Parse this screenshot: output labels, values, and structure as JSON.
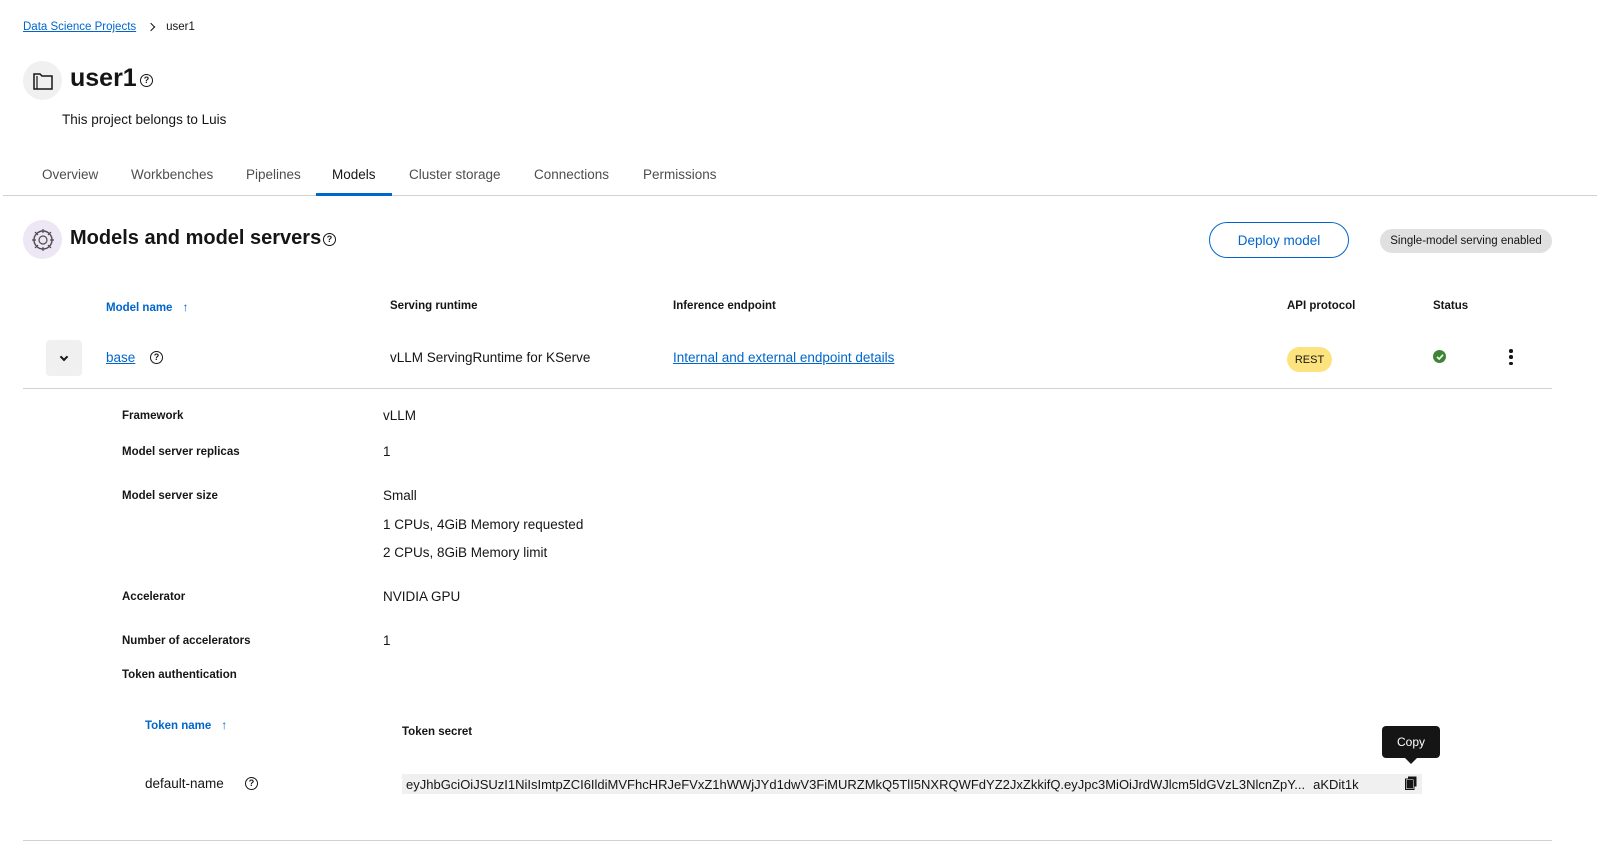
{
  "breadcrumb": {
    "parent": "Data Science Projects",
    "current": "user1"
  },
  "project": {
    "title": "user1",
    "description": "This project belongs to Luis",
    "help_glyph": "?"
  },
  "tabs": [
    {
      "label": "Overview",
      "active": false
    },
    {
      "label": "Workbenches",
      "active": false
    },
    {
      "label": "Pipelines",
      "active": false
    },
    {
      "label": "Models",
      "active": true
    },
    {
      "label": "Cluster storage",
      "active": false
    },
    {
      "label": "Connections",
      "active": false
    },
    {
      "label": "Permissions",
      "active": false
    }
  ],
  "section": {
    "title": "Models and model servers",
    "deploy_button": "Deploy model",
    "serving_badge": "Single-model serving enabled"
  },
  "table": {
    "columns": {
      "model_name": "Model name",
      "serving_runtime": "Serving runtime",
      "inference_endpoint": "Inference endpoint",
      "api_protocol": "API protocol",
      "status": "Status"
    },
    "rows": [
      {
        "model_name": "base",
        "serving_runtime": "vLLM ServingRuntime for KServe",
        "inference_endpoint": "Internal and external endpoint details",
        "api_protocol": "REST",
        "status": "ok"
      }
    ]
  },
  "details": {
    "framework_label": "Framework",
    "framework_value": "vLLM",
    "replicas_label": "Model server replicas",
    "replicas_value": "1",
    "size_label": "Model server size",
    "size_name": "Small",
    "size_requested": "1 CPUs, 4GiB Memory requested",
    "size_limit": "2 CPUs, 8GiB Memory limit",
    "accelerator_label": "Accelerator",
    "accelerator_value": "NVIDIA GPU",
    "num_accelerators_label": "Number of accelerators",
    "num_accelerators_value": "1",
    "token_auth_label": "Token authentication"
  },
  "tokens": {
    "columns": {
      "name": "Token name",
      "secret": "Token secret"
    },
    "rows": [
      {
        "name": "default-name",
        "secret_start": "eyJhbGciOiJSUzI1NiIsImtpZCI6IldiMVFhcHRJeFVxZ1hWWjJYd1dwV3FiMURZMkQ5TlI5NXRQWFdYZ2JxZkkifQ.eyJpc3MiOiJrdWJlcm5ldGVzL3NlcnZpY...",
        "secret_end": "aKDit1k"
      }
    ],
    "copy_tooltip": "Copy"
  },
  "colors": {
    "accent": "#0066cc",
    "status_ok": "#3e8635",
    "rest_badge": "#fce37e"
  },
  "icons": {
    "project": "folder-icon",
    "section": "brain-icon",
    "status": "check-circle-icon",
    "copy": "copy-icon",
    "kebab": "kebab-icon"
  }
}
